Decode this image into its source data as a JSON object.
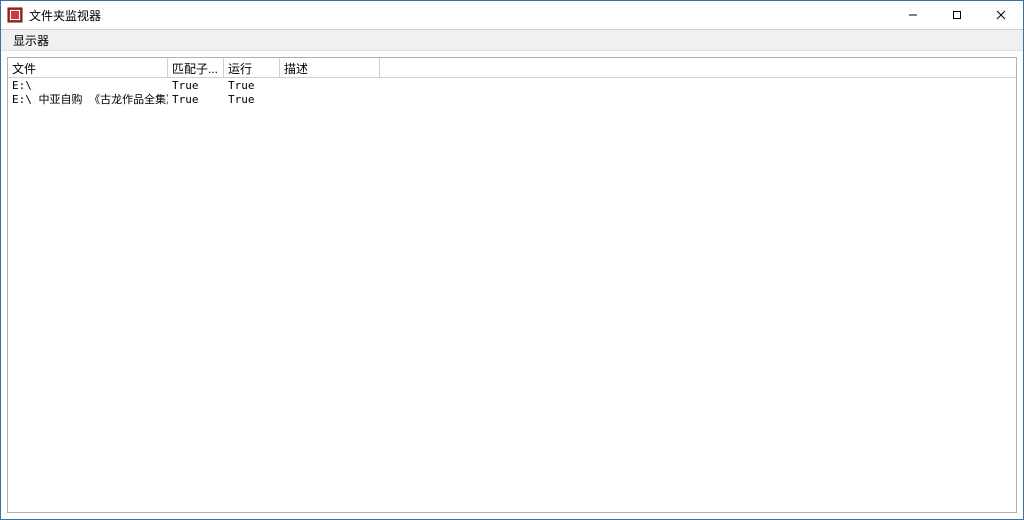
{
  "window": {
    "title": "文件夹监视器"
  },
  "menu": {
    "display": "显示器"
  },
  "list": {
    "columns": {
      "file": "文件",
      "match": "匹配子...",
      "run": "运行",
      "desc": "描述"
    },
    "rows": [
      {
        "file": "E:\\",
        "match": "True",
        "run": "True",
        "desc": ""
      },
      {
        "file": "E:\\ 中亚自购 《古龙作品全集》...",
        "match": "True",
        "run": "True",
        "desc": ""
      }
    ]
  },
  "win_controls": {
    "min": "—",
    "max": "☐",
    "close": "✕"
  }
}
